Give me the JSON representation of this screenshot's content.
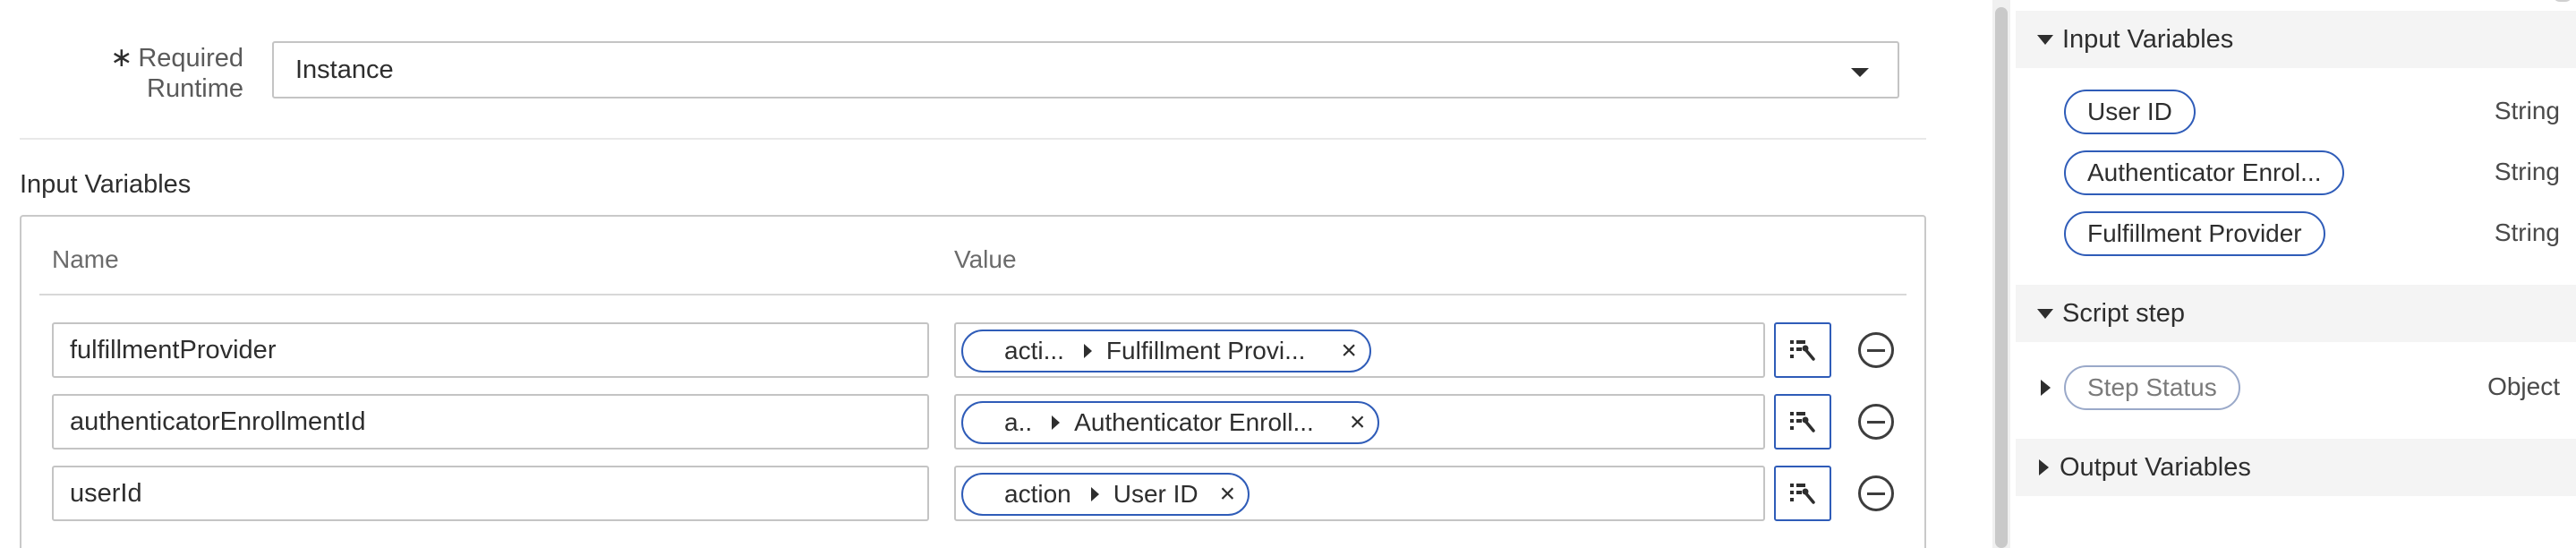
{
  "form": {
    "required_marker": "∗",
    "runtime_label_line1": "Required",
    "runtime_label_line2": "Runtime",
    "runtime_value": "Instance"
  },
  "input_variables": {
    "title": "Input Variables",
    "name_header": "Name",
    "value_header": "Value",
    "rows": [
      {
        "name": "fulfillmentProvider",
        "pill_prefix": "acti...",
        "pill_label": "Fulfillment Provi...",
        "remove": "×"
      },
      {
        "name": "authenticatorEnrollmentId",
        "pill_prefix": "a..",
        "pill_label": "Authenticator Enroll...",
        "remove": "×"
      },
      {
        "name": "userId",
        "pill_prefix": "action",
        "pill_label": "User ID",
        "remove": "×"
      }
    ]
  },
  "panel": {
    "input_section": "Input Variables",
    "input_vars": [
      {
        "label": "User ID",
        "type": "String"
      },
      {
        "label": "Authenticator Enrol...",
        "type": "String"
      },
      {
        "label": "Fulfillment Provider",
        "type": "String"
      }
    ],
    "script_section": "Script step",
    "script_vars": [
      {
        "label": "Step Status",
        "type": "Object"
      }
    ],
    "output_section": "Output Variables"
  },
  "colors": {
    "accent": "#2f5cb8",
    "panel_header_bg": "#f4f4f4",
    "border": "#c4c4c4"
  }
}
